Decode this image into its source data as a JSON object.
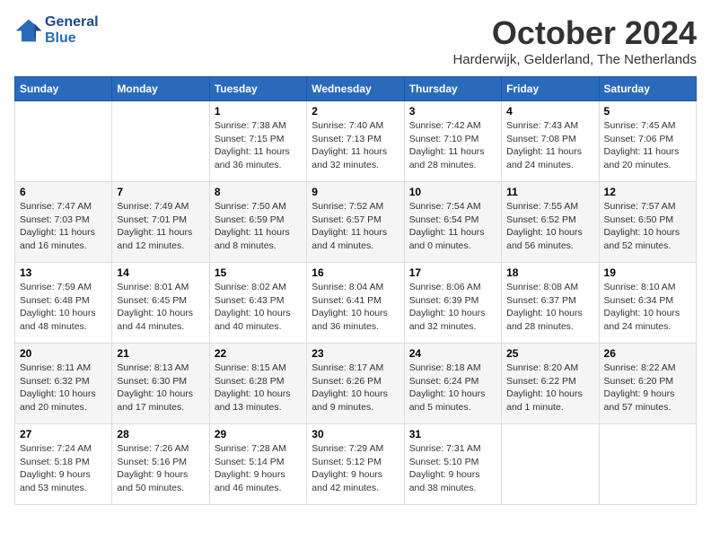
{
  "header": {
    "logo_line1": "General",
    "logo_line2": "Blue",
    "month_title": "October 2024",
    "location": "Harderwijk, Gelderland, The Netherlands"
  },
  "days_of_week": [
    "Sunday",
    "Monday",
    "Tuesday",
    "Wednesday",
    "Thursday",
    "Friday",
    "Saturday"
  ],
  "weeks": [
    [
      {
        "day": "",
        "content": ""
      },
      {
        "day": "",
        "content": ""
      },
      {
        "day": "1",
        "content": "Sunrise: 7:38 AM\nSunset: 7:15 PM\nDaylight: 11 hours\nand 36 minutes."
      },
      {
        "day": "2",
        "content": "Sunrise: 7:40 AM\nSunset: 7:13 PM\nDaylight: 11 hours\nand 32 minutes."
      },
      {
        "day": "3",
        "content": "Sunrise: 7:42 AM\nSunset: 7:10 PM\nDaylight: 11 hours\nand 28 minutes."
      },
      {
        "day": "4",
        "content": "Sunrise: 7:43 AM\nSunset: 7:08 PM\nDaylight: 11 hours\nand 24 minutes."
      },
      {
        "day": "5",
        "content": "Sunrise: 7:45 AM\nSunset: 7:06 PM\nDaylight: 11 hours\nand 20 minutes."
      }
    ],
    [
      {
        "day": "6",
        "content": "Sunrise: 7:47 AM\nSunset: 7:03 PM\nDaylight: 11 hours\nand 16 minutes."
      },
      {
        "day": "7",
        "content": "Sunrise: 7:49 AM\nSunset: 7:01 PM\nDaylight: 11 hours\nand 12 minutes."
      },
      {
        "day": "8",
        "content": "Sunrise: 7:50 AM\nSunset: 6:59 PM\nDaylight: 11 hours\nand 8 minutes."
      },
      {
        "day": "9",
        "content": "Sunrise: 7:52 AM\nSunset: 6:57 PM\nDaylight: 11 hours\nand 4 minutes."
      },
      {
        "day": "10",
        "content": "Sunrise: 7:54 AM\nSunset: 6:54 PM\nDaylight: 11 hours\nand 0 minutes."
      },
      {
        "day": "11",
        "content": "Sunrise: 7:55 AM\nSunset: 6:52 PM\nDaylight: 10 hours\nand 56 minutes."
      },
      {
        "day": "12",
        "content": "Sunrise: 7:57 AM\nSunset: 6:50 PM\nDaylight: 10 hours\nand 52 minutes."
      }
    ],
    [
      {
        "day": "13",
        "content": "Sunrise: 7:59 AM\nSunset: 6:48 PM\nDaylight: 10 hours\nand 48 minutes."
      },
      {
        "day": "14",
        "content": "Sunrise: 8:01 AM\nSunset: 6:45 PM\nDaylight: 10 hours\nand 44 minutes."
      },
      {
        "day": "15",
        "content": "Sunrise: 8:02 AM\nSunset: 6:43 PM\nDaylight: 10 hours\nand 40 minutes."
      },
      {
        "day": "16",
        "content": "Sunrise: 8:04 AM\nSunset: 6:41 PM\nDaylight: 10 hours\nand 36 minutes."
      },
      {
        "day": "17",
        "content": "Sunrise: 8:06 AM\nSunset: 6:39 PM\nDaylight: 10 hours\nand 32 minutes."
      },
      {
        "day": "18",
        "content": "Sunrise: 8:08 AM\nSunset: 6:37 PM\nDaylight: 10 hours\nand 28 minutes."
      },
      {
        "day": "19",
        "content": "Sunrise: 8:10 AM\nSunset: 6:34 PM\nDaylight: 10 hours\nand 24 minutes."
      }
    ],
    [
      {
        "day": "20",
        "content": "Sunrise: 8:11 AM\nSunset: 6:32 PM\nDaylight: 10 hours\nand 20 minutes."
      },
      {
        "day": "21",
        "content": "Sunrise: 8:13 AM\nSunset: 6:30 PM\nDaylight: 10 hours\nand 17 minutes."
      },
      {
        "day": "22",
        "content": "Sunrise: 8:15 AM\nSunset: 6:28 PM\nDaylight: 10 hours\nand 13 minutes."
      },
      {
        "day": "23",
        "content": "Sunrise: 8:17 AM\nSunset: 6:26 PM\nDaylight: 10 hours\nand 9 minutes."
      },
      {
        "day": "24",
        "content": "Sunrise: 8:18 AM\nSunset: 6:24 PM\nDaylight: 10 hours\nand 5 minutes."
      },
      {
        "day": "25",
        "content": "Sunrise: 8:20 AM\nSunset: 6:22 PM\nDaylight: 10 hours\nand 1 minute."
      },
      {
        "day": "26",
        "content": "Sunrise: 8:22 AM\nSunset: 6:20 PM\nDaylight: 9 hours\nand 57 minutes."
      }
    ],
    [
      {
        "day": "27",
        "content": "Sunrise: 7:24 AM\nSunset: 5:18 PM\nDaylight: 9 hours\nand 53 minutes."
      },
      {
        "day": "28",
        "content": "Sunrise: 7:26 AM\nSunset: 5:16 PM\nDaylight: 9 hours\nand 50 minutes."
      },
      {
        "day": "29",
        "content": "Sunrise: 7:28 AM\nSunset: 5:14 PM\nDaylight: 9 hours\nand 46 minutes."
      },
      {
        "day": "30",
        "content": "Sunrise: 7:29 AM\nSunset: 5:12 PM\nDaylight: 9 hours\nand 42 minutes."
      },
      {
        "day": "31",
        "content": "Sunrise: 7:31 AM\nSunset: 5:10 PM\nDaylight: 9 hours\nand 38 minutes."
      },
      {
        "day": "",
        "content": ""
      },
      {
        "day": "",
        "content": ""
      }
    ]
  ]
}
